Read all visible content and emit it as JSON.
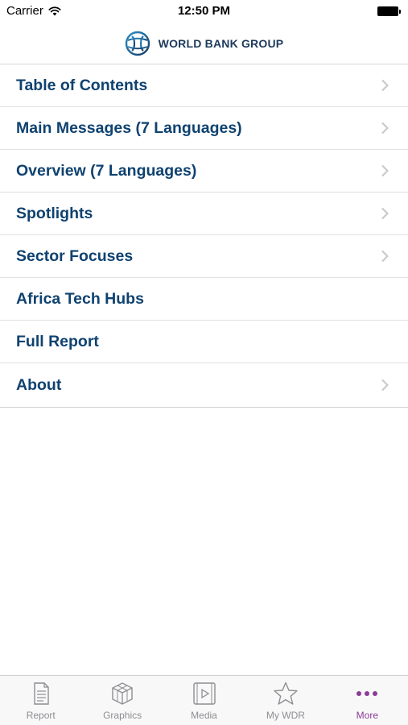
{
  "status_bar": {
    "carrier": "Carrier",
    "time": "12:50 PM"
  },
  "header": {
    "brand_name": "WORLD BANK GROUP",
    "logo_icon": "world-bank-globe-icon"
  },
  "menu": {
    "items": [
      {
        "label": "Table of Contents",
        "has_chevron": true
      },
      {
        "label": "Main Messages (7 Languages)",
        "has_chevron": true
      },
      {
        "label": "Overview (7 Languages)",
        "has_chevron": true
      },
      {
        "label": "Spotlights",
        "has_chevron": true
      },
      {
        "label": "Sector Focuses",
        "has_chevron": true
      },
      {
        "label": "Africa Tech Hubs",
        "has_chevron": false
      },
      {
        "label": "Full Report",
        "has_chevron": false
      },
      {
        "label": "About",
        "has_chevron": true
      }
    ]
  },
  "tab_bar": {
    "tabs": [
      {
        "label": "Report",
        "icon": "report-icon",
        "active": false
      },
      {
        "label": "Graphics",
        "icon": "graphics-icon",
        "active": false
      },
      {
        "label": "Media",
        "icon": "media-icon",
        "active": false
      },
      {
        "label": "My WDR",
        "icon": "star-icon",
        "active": false
      },
      {
        "label": "More",
        "icon": "more-icon",
        "active": true
      }
    ]
  },
  "colors": {
    "menu_text": "#0f4270",
    "brand_text": "#1d3a5c",
    "tab_inactive": "#8e8e93",
    "tab_active": "#8a3c96",
    "chevron": "#c7c7cc"
  }
}
